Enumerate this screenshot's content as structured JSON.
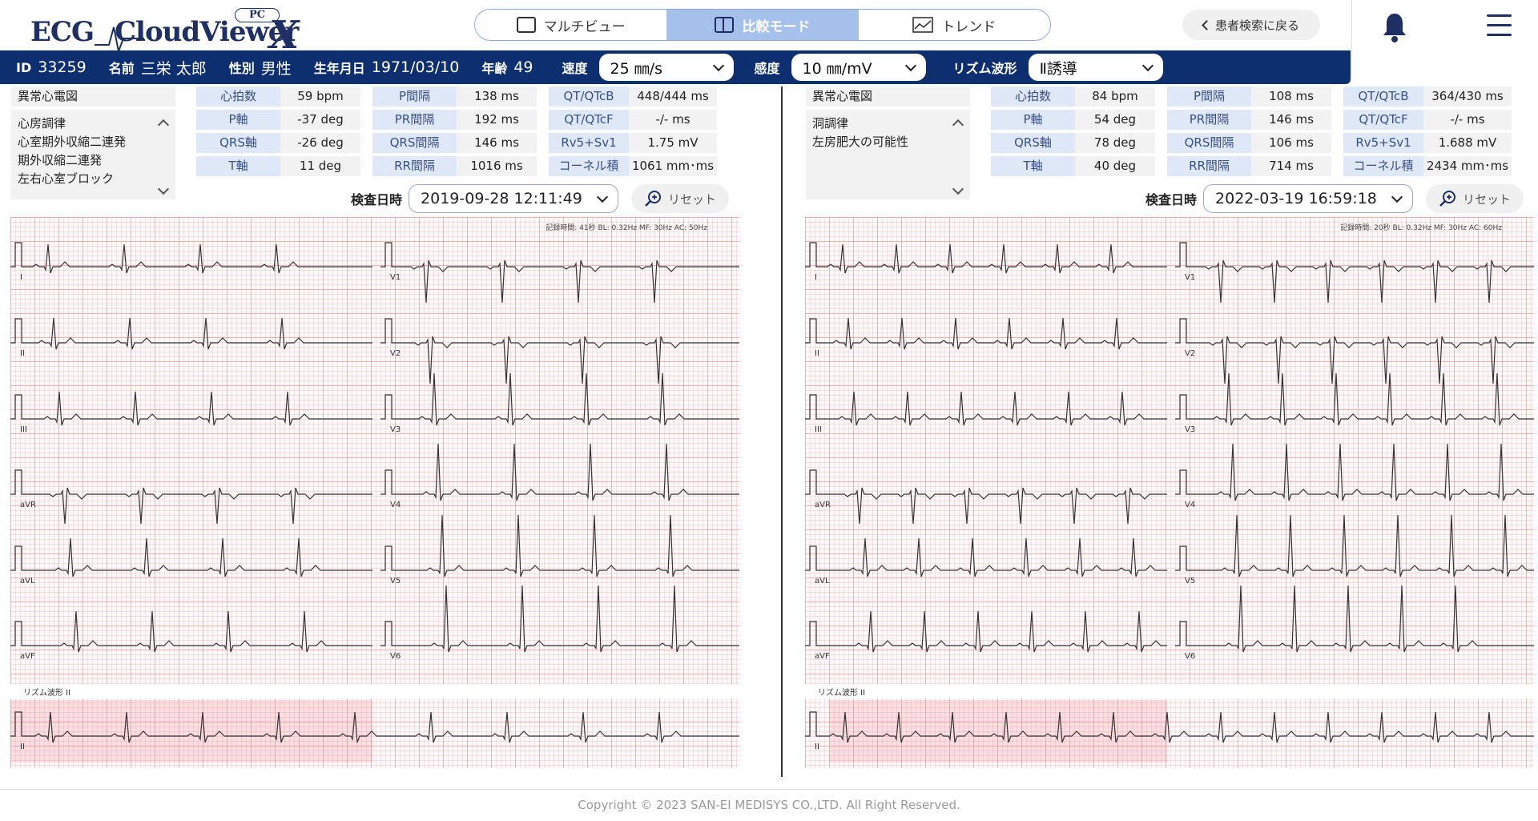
{
  "app": {
    "logo_ecg": "ECG",
    "logo_cloudviewer": "CloudViewer",
    "logo_x": "X",
    "logo_pc": "PC"
  },
  "modes": [
    {
      "label": "マルチビュー",
      "icon": "single-view-icon",
      "active": false
    },
    {
      "label": "比較モード",
      "icon": "compare-view-icon",
      "active": true
    },
    {
      "label": "トレンド",
      "icon": "trend-chart-icon",
      "active": false
    }
  ],
  "back_label": "患者検索に戻る",
  "patient": {
    "id_label": "ID",
    "id": "33259",
    "name_label": "名前",
    "name": "三栄 太郎",
    "sex_label": "性別",
    "sex": "男性",
    "dob_label": "生年月日",
    "dob": "1971/03/10",
    "age_label": "年齢",
    "age": "49"
  },
  "controls": {
    "speed_label": "速度",
    "speed": "25 ㎜/s",
    "sens_label": "感度",
    "sens": "10 ㎜/mV",
    "rhythm_label": "リズム波形",
    "rhythm": "Ⅱ誘導"
  },
  "left": {
    "abnormal_header": "異常心電図",
    "findings": [
      "心房調律",
      "心室期外収縮二連発",
      "期外収縮二連発",
      "左右心室ブロック"
    ],
    "metrics": [
      [
        "心拍数",
        "59 bpm"
      ],
      [
        "P軸",
        "-37 deg"
      ],
      [
        "QRS軸",
        "-26 deg"
      ],
      [
        "T軸",
        "11 deg"
      ],
      [
        "P間隔",
        "138 ms"
      ],
      [
        "PR間隔",
        "192 ms"
      ],
      [
        "QRS間隔",
        "146 ms"
      ],
      [
        "RR間隔",
        "1016 ms"
      ],
      [
        "QT/QTcB",
        "448/444 ms"
      ],
      [
        "QT/QTcF",
        "-/- ms"
      ],
      [
        "Rv5+Sv1",
        "1.75 mV"
      ],
      [
        "コーネル積",
        "1061 mm･ms"
      ]
    ],
    "exam_label": "検査日時",
    "exam_datetime": "2019-09-28 12:11:49",
    "reset_label": "リセット",
    "record_info": "記録時間: 41秒 BL: 0.32Hz MF: 30Hz AC: 50Hz",
    "rhythm_strip_label": "リズム波形 II"
  },
  "right": {
    "abnormal_header": "異常心電図",
    "findings": [
      "洞調律",
      "左房肥大の可能性"
    ],
    "metrics": [
      [
        "心拍数",
        "84 bpm"
      ],
      [
        "P軸",
        "54 deg"
      ],
      [
        "QRS軸",
        "78 deg"
      ],
      [
        "T軸",
        "40 deg"
      ],
      [
        "P間隔",
        "108 ms"
      ],
      [
        "PR間隔",
        "146 ms"
      ],
      [
        "QRS間隔",
        "106 ms"
      ],
      [
        "RR間隔",
        "714 ms"
      ],
      [
        "QT/QTcB",
        "364/430 ms"
      ],
      [
        "QT/QTcF",
        "-/- ms"
      ],
      [
        "Rv5+Sv1",
        "1.688 mV"
      ],
      [
        "コーネル積",
        "2434 mm･ms"
      ]
    ],
    "exam_label": "検査日時",
    "exam_datetime": "2022-03-19 16:59:18",
    "reset_label": "リセット",
    "record_info": "記録時間: 20秒 BL: 0.32Hz MF: 30Hz AC: 60Hz",
    "rhythm_strip_label": "リズム波形 II"
  },
  "leads_left": [
    "I",
    "II",
    "III",
    "aVR",
    "aVL",
    "aVF"
  ],
  "leads_right": [
    "V1",
    "V2",
    "V3",
    "V4",
    "V5",
    "V6"
  ],
  "rhythm_lead": "II",
  "footer": "Copyright © 2023 SAN-EI MEDISYS CO.,LTD. All Right Reserved.",
  "colors": {
    "navy": "#0e2f6f",
    "accent": "#a6c0ec",
    "grid": "#f08080"
  }
}
